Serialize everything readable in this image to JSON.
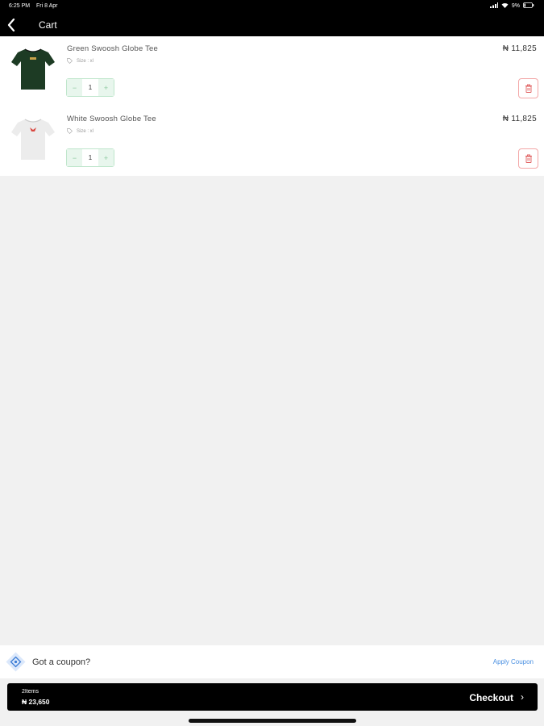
{
  "status_bar": {
    "time": "6:25 PM",
    "date": "Fri 8 Apr",
    "battery": "9%"
  },
  "nav": {
    "title": "Cart"
  },
  "cart": {
    "items": [
      {
        "name": "Green Swoosh Globe Tee",
        "size": "Size : xl",
        "price": "₦ 11,825",
        "quantity": "1",
        "shirt_color": "#1d3b24"
      },
      {
        "name": "White Swoosh Globe Tee",
        "size": "Size : xl",
        "price": "₦ 11,825",
        "quantity": "1",
        "shirt_color": "#ececec"
      }
    ],
    "decrement_symbol": "−",
    "increment_symbol": "+"
  },
  "coupon": {
    "prompt": "Got a coupon?",
    "apply_label": "Apply Coupon"
  },
  "checkout": {
    "items_count": "2Items",
    "total": "₦ 23,650",
    "label": "Checkout",
    "arrow": "›"
  },
  "colors": {
    "accent_blue": "#4a90e2",
    "stepper_green": "#bfe6cc",
    "delete_red": "#f3a7a7",
    "bar_black": "#000000"
  }
}
